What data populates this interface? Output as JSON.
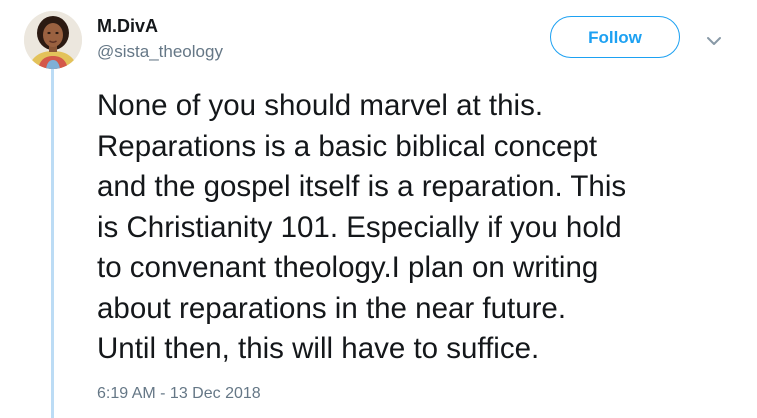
{
  "author": {
    "display_name": "M.DivA",
    "handle": "@sista_theology"
  },
  "actions": {
    "follow_label": "Follow",
    "more_icon": "chevron-down-icon"
  },
  "tweet": {
    "text": "None of you should marvel at this.\nReparations is a basic biblical concept\nand the gospel itself is a reparation. This\nis Christianity 101. Especially if you hold\nto convenant theology.I plan on writing\nabout reparations in the near future.\nUntil then, this will have to suffice.",
    "timestamp": "6:19 AM - 13 Dec 2018"
  },
  "colors": {
    "accent": "#1da1f2",
    "muted_text": "#657786",
    "thread_line": "#bcdcf5"
  }
}
